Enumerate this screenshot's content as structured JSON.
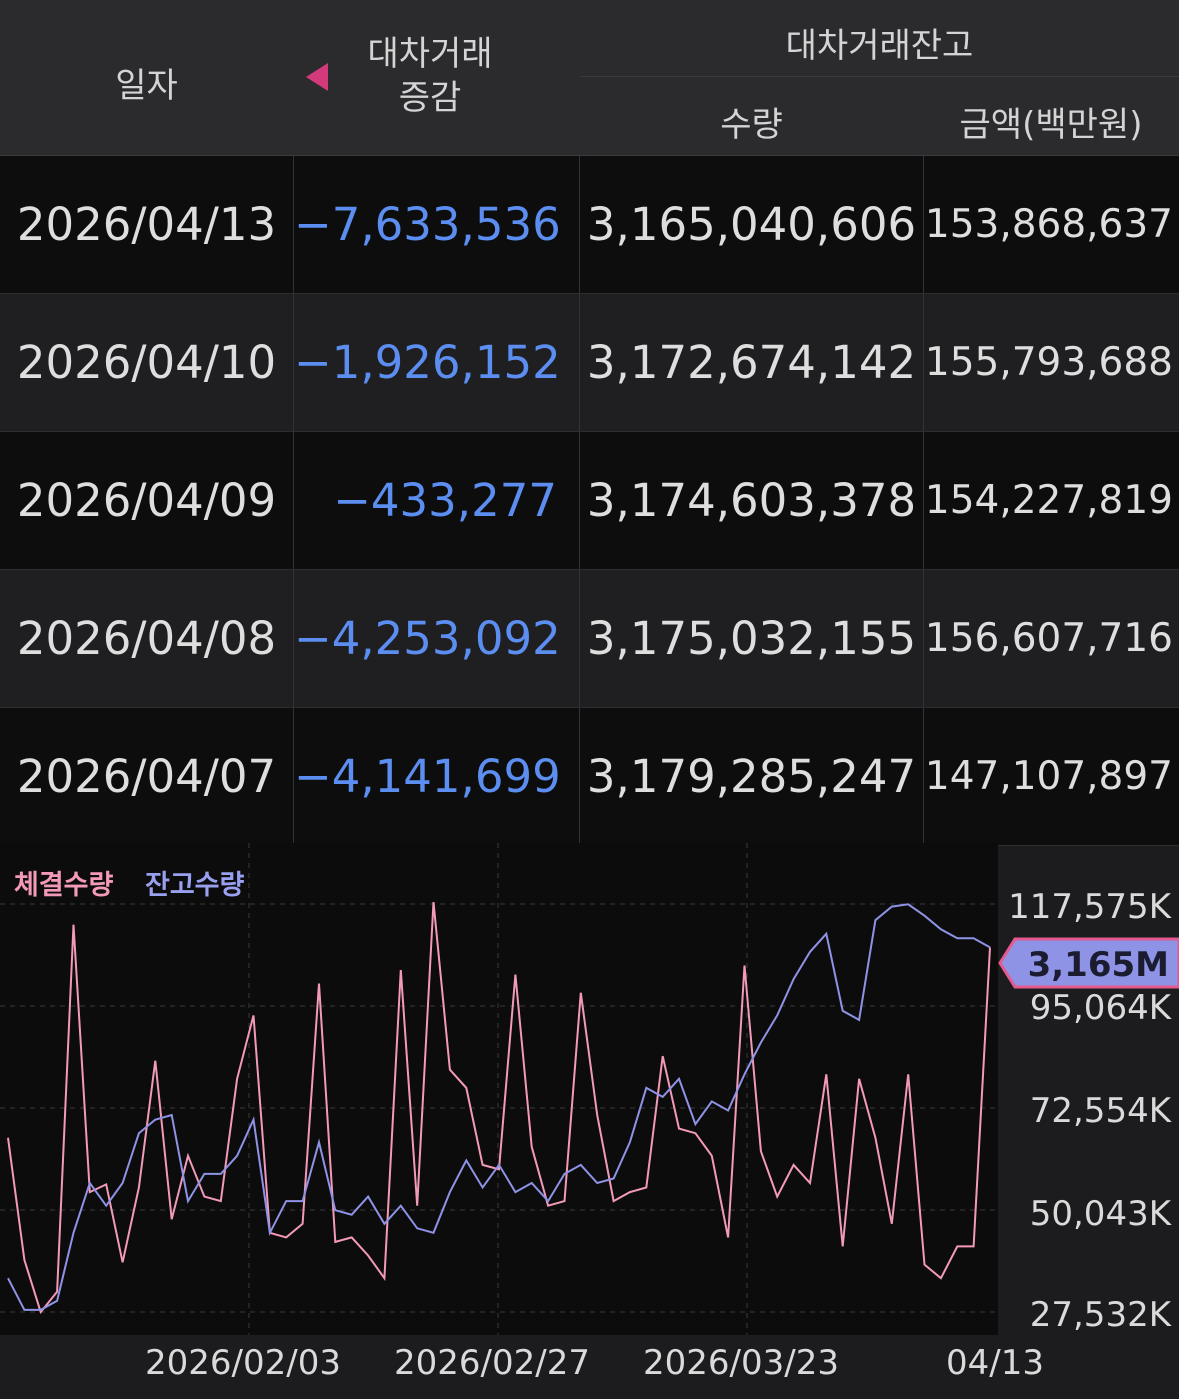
{
  "header": {
    "date_label": "일자",
    "change_label_1": "대차거래",
    "change_label_2": "증감",
    "balance_label": "대차거래잔고",
    "qty_label": "수량",
    "amount_label": "금액(백만원)"
  },
  "rows": [
    {
      "date": "2026/04/13",
      "change": "−7,633,536",
      "qty": "3,165,040,606",
      "amount": "153,868,637"
    },
    {
      "date": "2026/04/10",
      "change": "−1,926,152",
      "qty": "3,172,674,142",
      "amount": "155,793,688"
    },
    {
      "date": "2026/04/09",
      "change": "−433,277",
      "qty": "3,174,603,378",
      "amount": "154,227,819"
    },
    {
      "date": "2026/04/08",
      "change": "−4,253,092",
      "qty": "3,175,032,155",
      "amount": "156,607,716"
    },
    {
      "date": "2026/04/07",
      "change": "−4,141,699",
      "qty": "3,179,285,247",
      "amount": "147,107,897"
    }
  ],
  "colors": {
    "negative": "#5b8ef0",
    "execution_series": "#f39ab8",
    "balance_series": "#8e93e6",
    "highlight": "#d23a7c"
  },
  "chart_data": {
    "type": "line",
    "legend": [
      "체결수량",
      "잔고수량"
    ],
    "y_ticks": [
      "117,575K",
      "95,064K",
      "72,554K",
      "50,043K",
      "27,532K"
    ],
    "y_tick_values": [
      117575,
      95064,
      72554,
      50043,
      27532
    ],
    "x_ticks": [
      "2026/02/03",
      "2026/02/27",
      "2026/03/23",
      "04/13"
    ],
    "current_value_label": "3,165M",
    "ylim": [
      27532,
      117575
    ],
    "series": [
      {
        "name": "체결수량",
        "values": [
          66000,
          39000,
          27500,
          32000,
          113000,
          54000,
          55700,
          38500,
          55000,
          83000,
          48000,
          62000,
          53000,
          52000,
          79000,
          93000,
          45000,
          44000,
          47000,
          100000,
          43000,
          44000,
          40000,
          35000,
          103000,
          51000,
          118000,
          81000,
          77000,
          60000,
          59000,
          102000,
          64000,
          51000,
          52000,
          98000,
          71000,
          52000,
          54000,
          55000,
          84000,
          68000,
          67000,
          62000,
          44000,
          104000,
          63000,
          53000,
          60000,
          56000,
          80000,
          42000,
          79000,
          66000,
          47000,
          80000,
          38000,
          35000,
          42000,
          42000,
          108000
        ]
      },
      {
        "name": "잔고수량",
        "values": [
          35000,
          28000,
          28000,
          30000,
          45000,
          56000,
          51000,
          56000,
          67000,
          70000,
          71000,
          52000,
          58000,
          58000,
          62000,
          70000,
          45000,
          52000,
          52000,
          65000,
          50000,
          49000,
          53000,
          47000,
          51000,
          46000,
          45000,
          54000,
          61000,
          55000,
          60000,
          54000,
          56000,
          52000,
          58000,
          60000,
          56000,
          57000,
          65000,
          77000,
          75000,
          79000,
          69000,
          74000,
          72000,
          80000,
          87000,
          93000,
          101000,
          107000,
          111000,
          94000,
          92000,
          114000,
          117000,
          117500,
          115000,
          112000,
          110000,
          110000,
          108000
        ]
      }
    ]
  }
}
